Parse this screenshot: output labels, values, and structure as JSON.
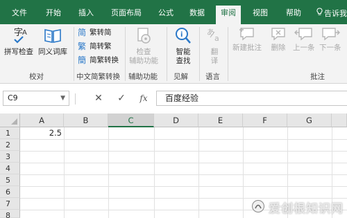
{
  "tabs": [
    {
      "label": "文件"
    },
    {
      "label": "开始"
    },
    {
      "label": "插入"
    },
    {
      "label": "页面布局"
    },
    {
      "label": "公式"
    },
    {
      "label": "数据"
    },
    {
      "label": "审阅"
    },
    {
      "label": "视图"
    },
    {
      "label": "帮助"
    },
    {
      "label": "告诉我"
    }
  ],
  "active_tab": "审阅",
  "ribbon": {
    "proofing": {
      "spelling": "拼写检查",
      "thesaurus": "同义词库",
      "group": "校对"
    },
    "chinese": {
      "to_traditional": "简转繁",
      "to_simplified_a": "繁转简",
      "to_simplified_b": "简繁转换",
      "group": "中文简繁转换"
    },
    "accessibility": {
      "line1": "检查",
      "line2": "辅助功能",
      "group": "辅助功能"
    },
    "insights": {
      "line1": "智能",
      "line2": "查找",
      "group": "见解"
    },
    "language": {
      "line1": "翻",
      "line2": "译",
      "group": "语言"
    },
    "comments": {
      "new": "新建批注",
      "delete": "删除",
      "prev": "上一条",
      "next": "下一条",
      "group": "批注"
    }
  },
  "formula_bar": {
    "name_box": "C9",
    "cancel": "✕",
    "enter": "✓",
    "fx": "fx",
    "content": "百度经验"
  },
  "sheet": {
    "columns": [
      "A",
      "B",
      "C",
      "D",
      "E",
      "F",
      "G"
    ],
    "rows": [
      "1",
      "2",
      "3",
      "4",
      "5",
      "6",
      "7",
      "8"
    ],
    "selected_column": "C",
    "cell_a1": "2.5"
  },
  "watermark": {
    "text": "爱创根知识网"
  },
  "colors": {
    "accent": "#217346",
    "ribbon_bg": "#f3f3f3"
  }
}
